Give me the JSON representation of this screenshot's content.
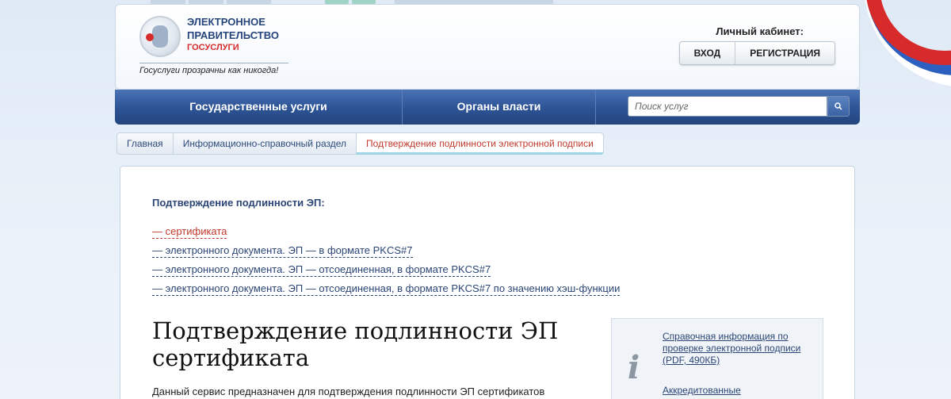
{
  "header": {
    "logo_line1": "ЭЛЕКТРОННОЕ",
    "logo_line2": "ПРАВИТЕЛЬСТВО",
    "logo_line3": "ГОСУСЛУГИ",
    "slogan": "Госуслуги прозрачны как никогда!",
    "cabinet_label": "Личный кабинет:",
    "login_label": "ВХОД",
    "register_label": "РЕГИСТРАЦИЯ"
  },
  "nav": {
    "items": [
      {
        "label": "Государственные услуги"
      },
      {
        "label": "Органы власти"
      }
    ],
    "search_placeholder": "Поиск услуг",
    "search_icon": "search-icon"
  },
  "breadcrumb": [
    {
      "label": "Главная"
    },
    {
      "label": "Информационно-справочный раздел"
    },
    {
      "label": "Подтверждение подлинности электронной подписи"
    }
  ],
  "content": {
    "section_title": "Подтверждение подлинности ЭП:",
    "links": [
      {
        "label": "— сертификата",
        "active": true
      },
      {
        "label": "— электронного документа. ЭП — в формате PKCS#7",
        "active": false
      },
      {
        "label": "— электронного документа. ЭП — отсоединенная, в формате PKCS#7",
        "active": false
      },
      {
        "label": "— электронного документа. ЭП — отсоединенная, в формате PKCS#7 по значению хэш-функции",
        "active": false
      }
    ],
    "heading": "Подтверждение подлинности ЭП сертификата",
    "paragraph": "Данный сервис предназначен для подтверждения подлинности ЭП сертификатов"
  },
  "info_box": {
    "icon": "info-icon",
    "icon_glyph": "i",
    "link1": "Справочная информация по проверке электронной подписи (PDF, 490КБ)",
    "link2": "Аккредитованные"
  },
  "colors": {
    "nav_blue": "#2f5597",
    "accent_red": "#c0392b",
    "link_blue": "#2b4676"
  }
}
